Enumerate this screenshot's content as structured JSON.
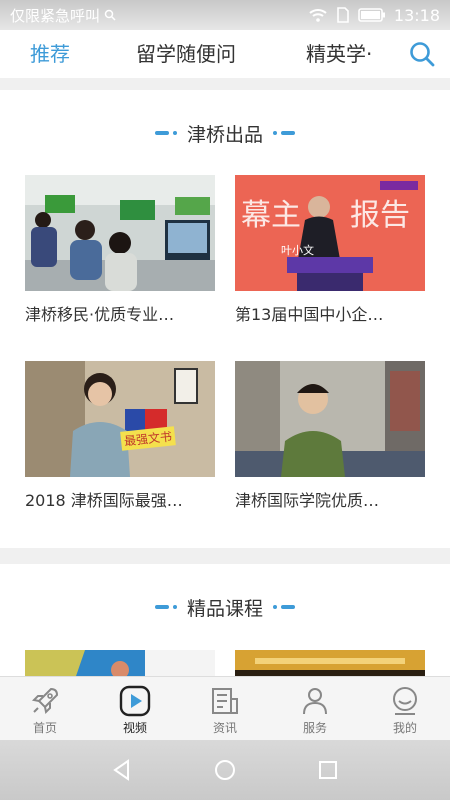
{
  "status_bar": {
    "carrier": "仅限紧急呼叫",
    "time": "13:18"
  },
  "top_tabs": [
    {
      "label": "推荐",
      "active": true
    },
    {
      "label": "留学随便问",
      "active": false
    },
    {
      "label": "精英学·",
      "active": false
    }
  ],
  "sections": [
    {
      "title": "津桥出品",
      "videos": [
        {
          "caption": "津桥移民·优质专业…",
          "thumb": "office-scene"
        },
        {
          "caption": "第13届中国中小企…",
          "thumb": "speaker-podium",
          "overlay_name": "叶小文"
        },
        {
          "caption": "2018 津桥国际最强…",
          "thumb": "student-interview",
          "overlay_text": "最强文书"
        },
        {
          "caption": "津桥国际学院优质…",
          "thumb": "student-sofa"
        }
      ]
    },
    {
      "title": "精品课程",
      "videos": []
    }
  ],
  "bottom_nav": [
    {
      "label": "首页",
      "icon": "rocket-icon",
      "active": false
    },
    {
      "label": "视频",
      "icon": "video-play-icon",
      "active": true
    },
    {
      "label": "资讯",
      "icon": "news-icon",
      "active": false
    },
    {
      "label": "服务",
      "icon": "person-icon",
      "active": false
    },
    {
      "label": "我的",
      "icon": "smiley-icon",
      "active": false
    }
  ],
  "colors": {
    "accent": "#3e9bd8",
    "text": "#333333",
    "background": "#f0f0f0"
  }
}
